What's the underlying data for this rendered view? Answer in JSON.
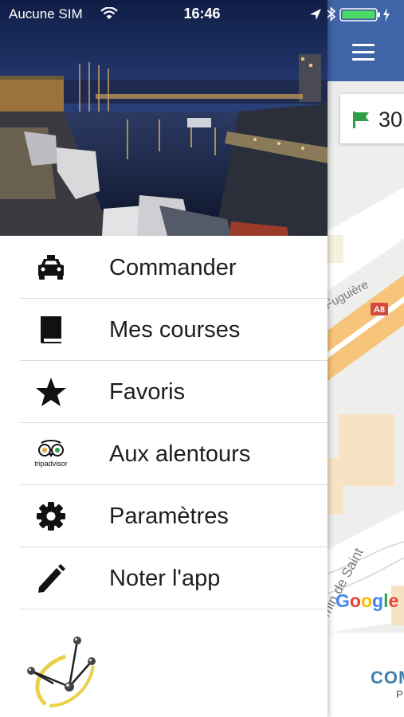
{
  "status_bar": {
    "carrier": "Aucune SIM",
    "time": "16:46"
  },
  "drawer": {
    "menu": [
      {
        "label": "Commander",
        "icon": "taxi-icon"
      },
      {
        "label": "Mes courses",
        "icon": "book-icon"
      },
      {
        "label": "Favoris",
        "icon": "star-icon"
      },
      {
        "label": "Aux alentours",
        "icon": "tripadvisor-logo-icon"
      },
      {
        "label": "Paramètres",
        "icon": "gear-icon"
      },
      {
        "label": "Noter l'app",
        "icon": "pencil-icon"
      }
    ],
    "tripadvisor_text": "tripadvisor"
  },
  "behind": {
    "destination_number": "30",
    "map_street_label": "Fuguière",
    "map_road_badge": "A8",
    "map_street_label_2": "hemin de Saint",
    "map_brand": "Google",
    "bottom_button": "COM",
    "bottom_sub": "P"
  },
  "colors": {
    "header_blue": "#3f64a8",
    "flag_green": "#2e9e44",
    "battery_green": "#4cd964",
    "road_orange": "#f6c47a"
  }
}
